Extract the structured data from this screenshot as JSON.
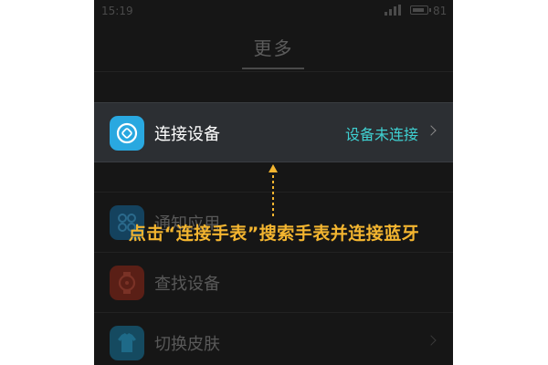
{
  "status_bar": {
    "time": "15:19",
    "battery": "81"
  },
  "header": {
    "title": "更多"
  },
  "rows": [
    {
      "label": "连接设备",
      "status": "设备未连接",
      "icon": "watch-link-icon"
    },
    {
      "label": "通知应用",
      "icon": "apps-grid-icon"
    },
    {
      "label": "查找设备",
      "icon": "watch-find-icon"
    },
    {
      "label": "切换皮肤",
      "icon": "shirt-icon"
    }
  ],
  "annotation": {
    "text": "点击“连接手表”搜索手表并连接蓝牙"
  },
  "colors": {
    "accent": "#3fd1d2",
    "annotation": "#f3b530",
    "icon_connect": "#29a8e0",
    "icon_notify": "#1f6fa0",
    "icon_find": "#c0392b",
    "icon_skin": "#2b8fb8"
  }
}
